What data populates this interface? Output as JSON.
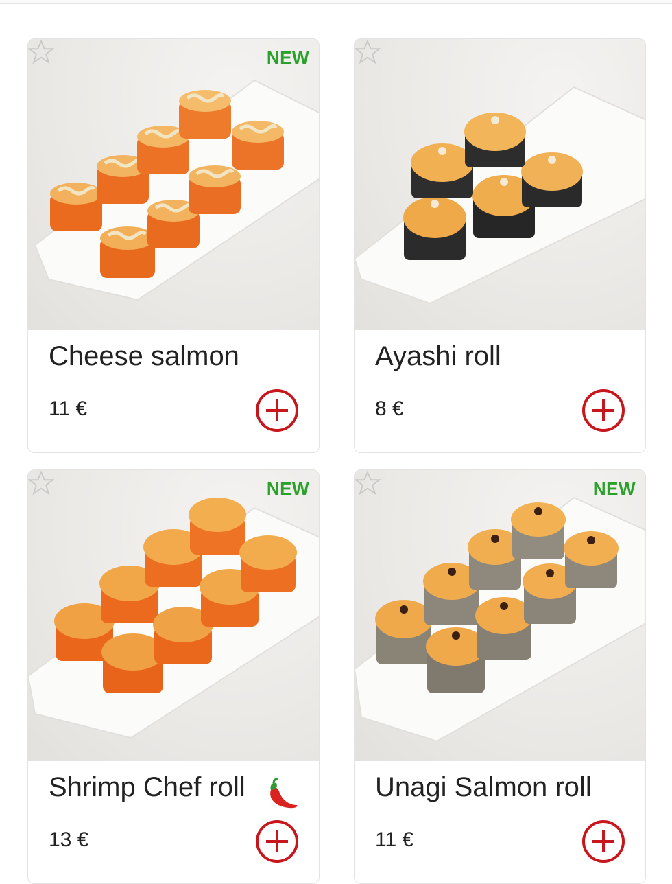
{
  "currency_note": "€",
  "colors": {
    "new_badge": "#2aa12a",
    "add_button": "#c8161d"
  },
  "products": [
    {
      "name": "Cheese salmon",
      "price": "11 €",
      "badge": "NEW",
      "spicy": false,
      "favorite_icon": "star-outline-icon",
      "add_icon": "plus-circle-icon"
    },
    {
      "name": "Ayashi roll",
      "price": "8 €",
      "badge": "",
      "spicy": false,
      "favorite_icon": "star-outline-icon",
      "add_icon": "plus-circle-icon"
    },
    {
      "name": "Shrimp Chef roll",
      "price": "13 €",
      "badge": "NEW",
      "spicy": true,
      "spicy_icon": "chili-pepper-icon",
      "favorite_icon": "star-outline-icon",
      "add_icon": "plus-circle-icon"
    },
    {
      "name": "Unagi Salmon roll",
      "price": "11 €",
      "badge": "NEW",
      "spicy": false,
      "favorite_icon": "star-outline-icon",
      "add_icon": "plus-circle-icon"
    }
  ]
}
